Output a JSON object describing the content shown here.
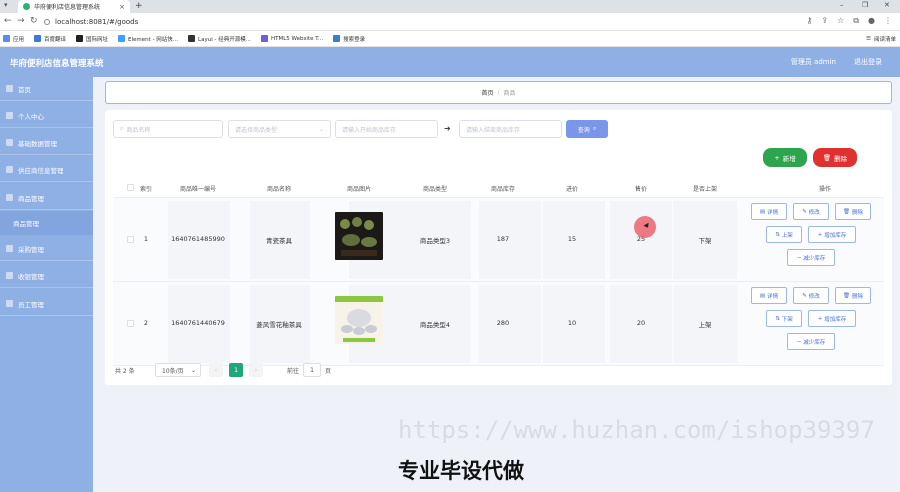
{
  "browser": {
    "tab_title": "毕府便利店信息管理系统",
    "url": "localhost:8081/#/goods",
    "bookmarks": [
      {
        "label": "应用",
        "color": "#5b8def"
      },
      {
        "label": "百度翻译",
        "color": "#3a7bd5"
      },
      {
        "label": "国际网址",
        "color": "#222222"
      },
      {
        "label": "Element - 网站快...",
        "color": "#409eff"
      },
      {
        "label": "Layui - 经典开源模...",
        "color": "#333333"
      },
      {
        "label": "HTML5 Website T...",
        "color": "#6d5ce8"
      },
      {
        "label": "搜索登录",
        "color": "#3a7bd5"
      }
    ],
    "reading_list": "阅读清单"
  },
  "header": {
    "title": "毕府便利店信息管理系统",
    "admin": "管理员 admin",
    "logout": "退出登录"
  },
  "sidebar": {
    "items": [
      {
        "label": "首页",
        "icon": "home-icon"
      },
      {
        "label": "个人中心",
        "icon": "user-icon"
      },
      {
        "label": "基础数据管理",
        "icon": "data-icon"
      },
      {
        "label": "供应商信息管理",
        "icon": "supplier-icon"
      },
      {
        "label": "商品管理",
        "icon": "goods-icon"
      },
      {
        "label": "商品管理",
        "icon": ""
      },
      {
        "label": "采购管理",
        "icon": "purchase-icon"
      },
      {
        "label": "收银管理",
        "icon": "cashier-icon"
      },
      {
        "label": "员工管理",
        "icon": "staff-icon"
      }
    ]
  },
  "breadcrumb": {
    "home": "首页",
    "separator": "/",
    "current": "商品"
  },
  "filters": {
    "name_placeholder": "商品名称",
    "type_placeholder": "请选择商品类型",
    "stock_min_placeholder": "请输入开始商品库存",
    "arrow": "➜",
    "stock_max_placeholder": "请输入结束商品库存",
    "search_label": "查询"
  },
  "actions": {
    "add_label": "新增",
    "delete_label": "删除"
  },
  "table": {
    "headers": [
      "索引",
      "商品唯一编号",
      "商品名称",
      "商品图片",
      "商品类型",
      "商品库存",
      "进价",
      "售价",
      "是否上架",
      "操作"
    ],
    "rows": [
      {
        "index": "1",
        "code": "1640761485990",
        "name": "青瓷茶具",
        "type": "商品类型3",
        "stock": "187",
        "cost": "15",
        "price": "25",
        "status": "下架",
        "ops": [
          "详情",
          "修改",
          "删除",
          "上架",
          "增加库存",
          "减少库存"
        ]
      },
      {
        "index": "2",
        "code": "1640761440679",
        "name": "菱风雪花釉茶具",
        "type": "商品类型4",
        "stock": "280",
        "cost": "10",
        "price": "20",
        "status": "上架",
        "ops": [
          "详情",
          "修改",
          "删除",
          "下架",
          "增加库存",
          "减少库存"
        ]
      }
    ]
  },
  "pagination": {
    "total": "共 2 条",
    "page_size": "10条/页",
    "current_page": "1",
    "goto_label": "前往",
    "goto_value": "1",
    "page_suffix": "页"
  },
  "overlay": {
    "watermark": "https://www.huzhan.com/ishop39397",
    "banner": "专业毕设代做"
  }
}
